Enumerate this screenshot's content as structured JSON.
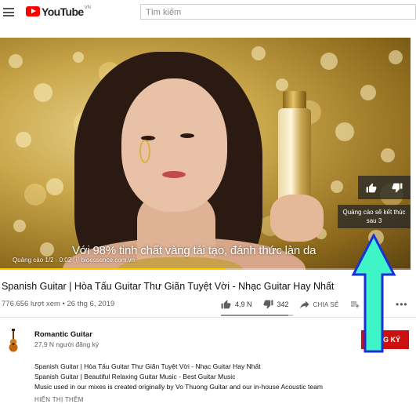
{
  "header": {
    "logo_text": "YouTube",
    "logo_country": "VN",
    "search_placeholder": "Tìm kiếm"
  },
  "video": {
    "ad_caption": "Với 98% tinh chất vàng tái tạo, đánh thức làn da",
    "ad_info": "Quảng cáo 1/2 · 0:02 ⓘ bioessence.com.vn",
    "skip_text": "Quảng cáo sẽ kết thúc sau 3",
    "ad_progress_fraction": 0.55
  },
  "title": "Spanish Guitar | Hòa Tấu Guitar Thư Giãn Tuyệt Vời - Nhạc Guitar Hay Nhất",
  "meta": "776.656 lượt xem • 26 thg 6, 2019",
  "actions": {
    "like_count": "4,9 N",
    "dislike_count": "342",
    "share_label": "CHIA SẺ",
    "like_fraction": 0.935
  },
  "channel": {
    "name": "Romantic Guitar",
    "subscribers": "27,9 N người đăng ký",
    "subscribe_label": "ĐĂNG KÝ"
  },
  "description": {
    "lines": [
      "Spanish Guitar | Hòa Tấu Guitar Thư Giãn Tuyệt Vời - Nhạc Guitar Hay Nhất",
      "Spanish Guitar | Beautiful Relaxing Guitar Music - Best Guitar Music",
      "Music used in our mixes is created originally by Vo Thuong Guitar and our in-house Acoustic  team"
    ],
    "show_more": "HIỂN THỊ THÊM"
  },
  "colors": {
    "brand_red": "#ff0000",
    "subscribe_red": "#cc1010",
    "annotation_fill": "#3ff5c8",
    "annotation_stroke": "#1b2fd6"
  }
}
